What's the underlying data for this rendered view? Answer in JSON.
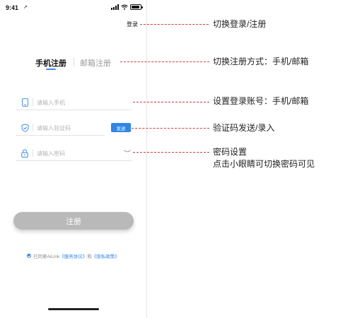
{
  "status_bar": {
    "time": "9:41",
    "location_glyph": "➚"
  },
  "header": {
    "toggle_label": "登录"
  },
  "tabs": [
    {
      "label": "手机注册",
      "active": true
    },
    {
      "label": "邮箱注册",
      "active": false
    }
  ],
  "form": {
    "phone_placeholder": "请输入手机",
    "code_placeholder": "请输入验证码",
    "password_placeholder": "请输入密码",
    "send_label": "发送",
    "submit_label": "注册"
  },
  "agreement": {
    "prefix": "已同意AiLink",
    "terms": "《服务协议》",
    "conjunction": "和",
    "privacy": "《隐私政策》"
  },
  "annotations": [
    {
      "text": "切换登录/注册"
    },
    {
      "text": "切换注册方式：手机/邮箱"
    },
    {
      "text": "设置登录账号：手机/邮箱"
    },
    {
      "text": "验证码发送/录入"
    },
    {
      "text": "密码设置"
    },
    {
      "text": "点击小眼睛可切换密码可见"
    }
  ],
  "colors": {
    "accent": "#2f86e8",
    "annotation_line": "#d83a3a",
    "button_disabled": "#b9b9b9"
  }
}
